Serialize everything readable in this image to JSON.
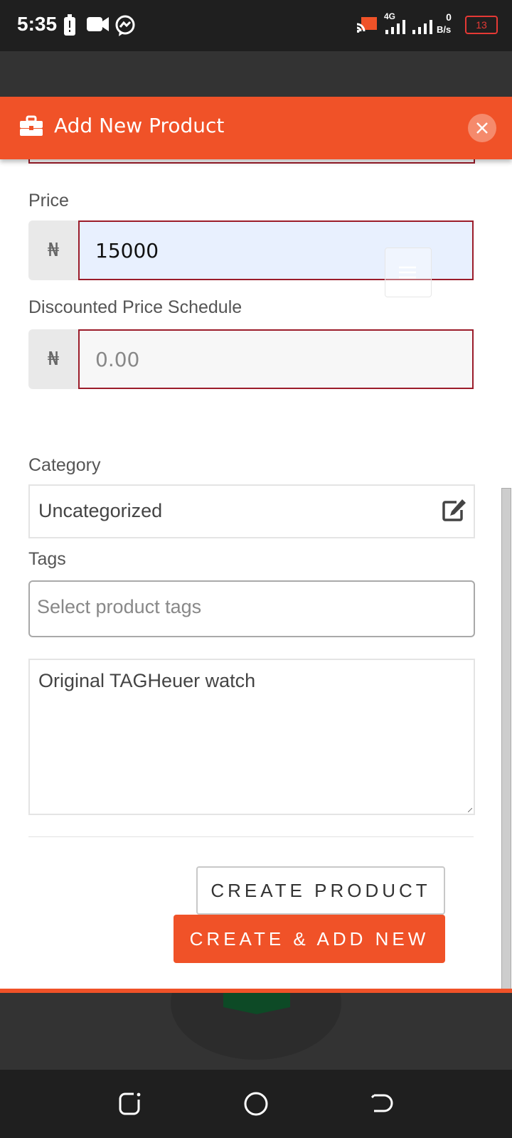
{
  "status_bar": {
    "time": "5:35",
    "network": "4G",
    "speed_value": "0",
    "speed_unit": "B/s",
    "battery": "13"
  },
  "modal": {
    "title": "Add New Product",
    "accent_color": "#f05228",
    "error_border_color": "#9b1c2a"
  },
  "form": {
    "price": {
      "label": "Price",
      "currency": "₦",
      "value": "15000"
    },
    "discount": {
      "label": "Discounted Price Schedule",
      "currency": "₦",
      "placeholder": "0.00"
    },
    "category": {
      "label": "Category",
      "value": "Uncategorized"
    },
    "tags": {
      "label": "Tags",
      "placeholder": "Select product tags"
    },
    "description": {
      "value": "Original TAGHeuer watch"
    }
  },
  "actions": {
    "create_label": "CREATE PRODUCT",
    "create_add_label": "CREATE & ADD NEW"
  }
}
